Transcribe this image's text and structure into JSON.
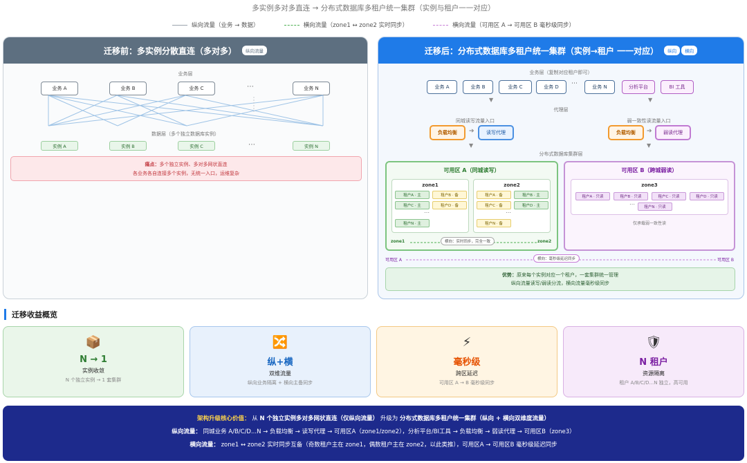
{
  "title": "多实例多对多直连 → 分布式数据库多租户统一集群（实例与租户一一对应）",
  "legend": [
    {
      "label": "纵向流量（业务 → 数据）",
      "color": "#9aa3ad",
      "style": "solid"
    },
    {
      "label": "横向流量（zone1 ↔ zone2 实时同步）",
      "color": "#4caf50",
      "style": "dashed"
    },
    {
      "label": "横向流量（可用区 A → 可用区 B 毫秒级同步）",
      "color": "#c77dd6",
      "style": "dashed"
    }
  ],
  "before": {
    "title": "迁移前：多实例分散直连（多对多）",
    "tag": "纵向流量",
    "biz_layer_label": "业务层",
    "biz": [
      "业务 A",
      "业务 B",
      "业务 C",
      "业务 N"
    ],
    "ellipsis": "⋯",
    "data_layer_label": "数据层（多个独立数据库实例）",
    "instances": [
      "实例 A",
      "实例 B",
      "实例 C",
      "实例 N"
    ],
    "pain_title": "痛点：",
    "pain_line1": "多个独立实例、多对多网状直连",
    "pain_line2": "各业务各自连接多个实例，无统一入口，运维复杂"
  },
  "after": {
    "title": "迁移后：分布式数据库多租户统一集群（实例→租户 一一对应）",
    "tags": [
      "纵向",
      "横向"
    ],
    "biz_layer_label": "业务层（复制对应租户即可）",
    "biz": [
      "业务 A",
      "业务 B",
      "业务 C",
      "业务 D",
      "业务 N"
    ],
    "ellipsis": "⋯",
    "analytics": [
      "分析平台",
      "BI 工具"
    ],
    "proxy_layer_label": "代理层",
    "rw_entry_label": "同城读写流量入口",
    "weak_entry_label": "弱一致性读流量入口",
    "lb": "负载均衡",
    "rw_proxy": "读写代理",
    "weak_proxy": "弱读代理",
    "cluster_label": "分布式数据库集群层",
    "zone_a_title": "可用区 A（同城读写）",
    "zone_b_title": "可用区 B（跨城弱读）",
    "zone1": {
      "name": "zone1",
      "tenants": [
        "租户A · 主",
        "租户B · 备",
        "租户C · 主",
        "租户D · 备",
        "租户N · 主"
      ]
    },
    "zone2": {
      "name": "zone2",
      "tenants": [
        "租户A · 备",
        "租户B · 主",
        "租户C · 备",
        "租户D · 主",
        "租户N · 备"
      ]
    },
    "zone3": {
      "name": "zone3",
      "tenants": [
        "租户A · 只读",
        "租户B · 只读",
        "租户C · 只读",
        "租户D · 只读",
        "租户N · 只读"
      ],
      "note": "仅承载弱一致性读"
    },
    "sync_pill": "横向：实时同步，完全一致",
    "zone1_label": "zone1",
    "zone2_label": "zone2",
    "az_a_label": "可用区 A",
    "az_b_label": "可用区 B",
    "ms_pill": "横向：毫秒级延迟同步",
    "adv_title": "优势：",
    "adv_line1": "原来每个实例对应一个租户，一套集群统一管理",
    "adv_line2": "纵向流量读写/弱读分流，横向流量毫秒级同步"
  },
  "section_title": "迁移收益概览",
  "cards": [
    {
      "icon": "📦",
      "big": "N → 1",
      "mid": "实例收敛",
      "sm": "N 个独立实例 → 1 套集群",
      "bg": "#eaf6ea",
      "border": "#a8d5aa",
      "color": "#2e7d32"
    },
    {
      "icon": "🔀",
      "big": "纵+横",
      "mid": "双维流量",
      "sm": "纵向业务隔离 + 横向主备同步",
      "bg": "#e8f1fc",
      "border": "#a6c6ec",
      "color": "#1565c0"
    },
    {
      "icon": "⚡",
      "big": "毫秒级",
      "mid": "跨区延迟",
      "sm": "可用区 A → B 毫秒级同步",
      "bg": "#fff5e3",
      "border": "#f3c883",
      "color": "#e65100"
    },
    {
      "icon": "🛡",
      "big": "N 租户",
      "mid": "资源隔离",
      "sm": "租户 A/B/C/D...N 独立，高可用",
      "bg": "#f7eafa",
      "border": "#d8b0e3",
      "color": "#7b1fa2"
    }
  ],
  "bottom": {
    "l1_label": "架构升级核心价值：",
    "l1_a": "从",
    "l1_b": "N 个独立实例多对多网状直连（仅纵向流量）",
    "l1_c": "升级为",
    "l1_d": "分布式数据库多租户统一集群（纵向 + 横向双维度流量）",
    "l2_label": "纵向流量：",
    "l2_text": "同城业务 A/B/C/D...N → 负载均衡 → 读写代理 → 可用区A（zone1/zone2），分析平台/BI工具 → 负载均衡 → 弱读代理 → 可用区B（zone3）",
    "l3_label": "横向流量：",
    "l3_text": "zone1 ↔ zone2 实时同步互备（奇数租户主在 zone1，偶数租户主在 zone2，以此类推），可用区A → 可用区B 毫秒级延迟同步"
  }
}
